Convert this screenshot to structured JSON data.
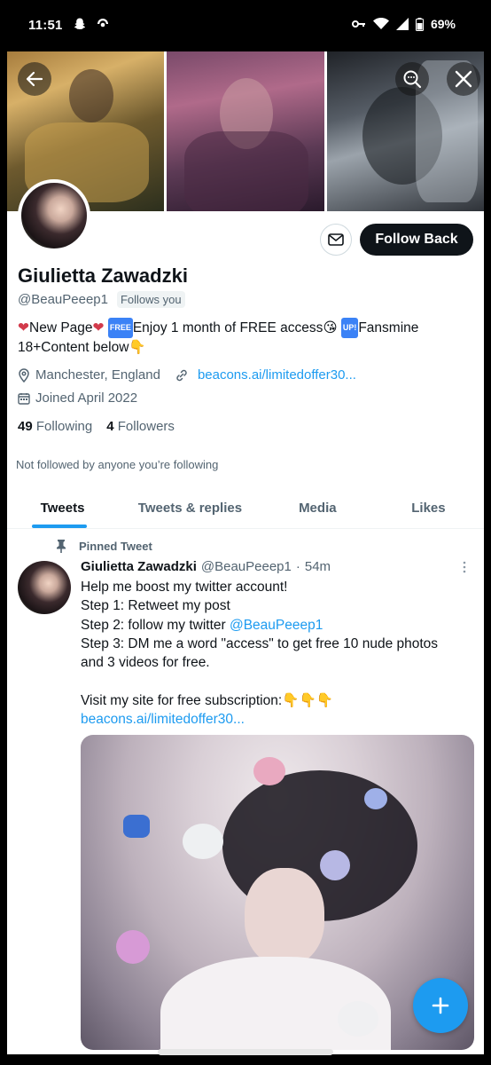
{
  "status_bar": {
    "time": "11:51",
    "battery": "69%",
    "icons": [
      "snapchat-icon",
      "notification-icon",
      "vpn-key-icon",
      "wifi-icon",
      "signal-icon",
      "battery-icon"
    ]
  },
  "profile": {
    "name": "Giulietta Zawadzki",
    "handle": "@BeauPeeep1",
    "follows_you": "Follows you",
    "bio": {
      "heart1": "❤",
      "part1": "New Page",
      "heart2": "❤",
      "free_badge": "FREE",
      "part2": "Enjoy 1 month of FREE access",
      "kiss": "😘",
      "up_badge": "UP!",
      "part3": "Fansmine",
      "line2": "18+Content below",
      "hand": "👇"
    },
    "location": "Manchester, England",
    "link": "beacons.ai/limitedoffer30...",
    "joined": "Joined April 2022",
    "following_count": "49",
    "following_label": "Following",
    "followers_count": "4",
    "followers_label": "Followers",
    "not_followed": "Not followed by anyone you’re following",
    "follow_back_label": "Follow Back"
  },
  "tabs": [
    {
      "label": "Tweets",
      "active": true
    },
    {
      "label": "Tweets & replies",
      "active": false
    },
    {
      "label": "Media",
      "active": false
    },
    {
      "label": "Likes",
      "active": false
    }
  ],
  "tweet": {
    "pinned_label": "Pinned Tweet",
    "name": "Giulietta Zawadzki",
    "handle": "@BeauPeeep1",
    "sep": "·",
    "time": "54m",
    "lines": [
      "Help me boost my twitter account!",
      "Step 1: Retweet my post",
      "Step 2: follow my twitter",
      "Step 3: DM me a word \"access\" to get free 10 nude photos",
      "and 3 videos for free.",
      "",
      "Visit my site for free subscription:"
    ],
    "mention": "@BeauPeeep1",
    "hands": "👇👇👇",
    "link": "beacons.ai/limitedoffer30..."
  },
  "colors": {
    "accent": "#1d9bf0",
    "text_primary": "#0f1419",
    "text_secondary": "#536471",
    "button_dark": "#0f1419"
  }
}
